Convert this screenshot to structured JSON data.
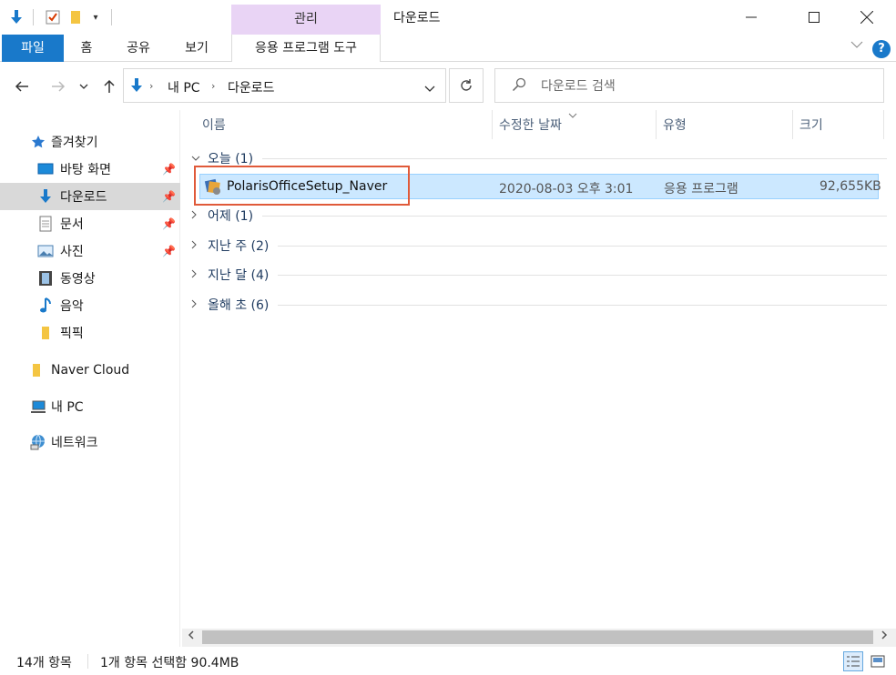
{
  "window": {
    "title": "다운로드",
    "context_tab": "관리",
    "controls": [
      "minimize",
      "maximize",
      "close"
    ]
  },
  "ribbon": {
    "tabs": [
      "파일",
      "홈",
      "공유",
      "보기",
      "응용 프로그램 도구"
    ]
  },
  "address": {
    "segments": [
      "내 PC",
      "다운로드"
    ]
  },
  "search": {
    "placeholder": "다운로드 검색"
  },
  "sidebar": {
    "items": [
      {
        "label": "즐겨찾기",
        "icon": "star-icon"
      },
      {
        "label": "바탕 화면",
        "icon": "desktop-icon",
        "pinned": true
      },
      {
        "label": "다운로드",
        "icon": "download-arrow-icon",
        "pinned": true,
        "selected": true
      },
      {
        "label": "문서",
        "icon": "document-icon",
        "pinned": true
      },
      {
        "label": "사진",
        "icon": "pictures-icon",
        "pinned": true
      },
      {
        "label": "동영상",
        "icon": "video-icon"
      },
      {
        "label": "음악",
        "icon": "music-icon"
      },
      {
        "label": "픽픽",
        "icon": "folder-icon"
      },
      {
        "label": "Naver Cloud",
        "icon": "folder-icon"
      },
      {
        "label": "내 PC",
        "icon": "pc-icon"
      },
      {
        "label": "네트워크",
        "icon": "network-icon"
      }
    ]
  },
  "columns": {
    "name": "이름",
    "modified": "수정한 날짜",
    "type": "유형",
    "size": "크기"
  },
  "groups": [
    {
      "label": "오늘 (1)",
      "expanded": true
    },
    {
      "label": "어제 (1)",
      "expanded": false
    },
    {
      "label": "지난 주 (2)",
      "expanded": false
    },
    {
      "label": "지난 달 (4)",
      "expanded": false
    },
    {
      "label": "올해 초 (6)",
      "expanded": false
    }
  ],
  "files": [
    {
      "name": "PolarisOfficeSetup_Naver",
      "modified": "2020-08-03 오후 3:01",
      "type": "응용 프로그램",
      "size": "92,655KB",
      "selected": true
    }
  ],
  "status": {
    "item_count": "14개 항목",
    "selection": "1개 항목 선택함 90.4MB"
  },
  "colors": {
    "accent": "#1979ca",
    "manage_tab": "#e9d4f5",
    "selection_bg": "#cce8ff",
    "highlight_box": "#e05a3a"
  }
}
